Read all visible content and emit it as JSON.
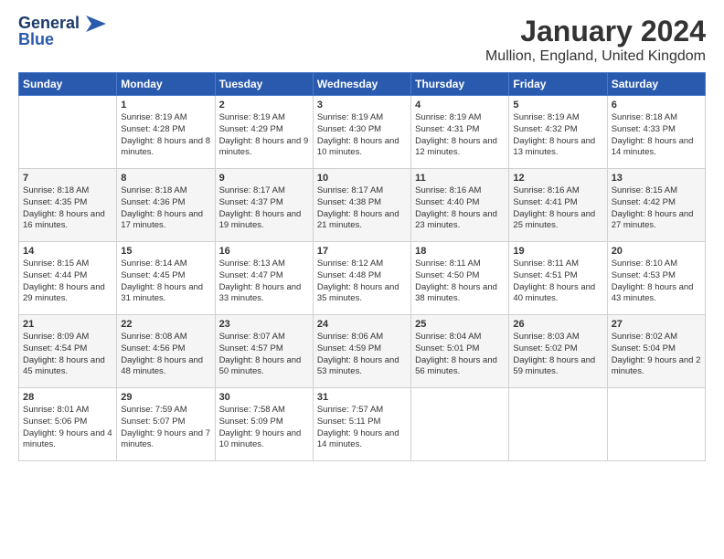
{
  "logo": {
    "line1": "General",
    "line2": "Blue"
  },
  "title": "January 2024",
  "subtitle": "Mullion, England, United Kingdom",
  "colors": {
    "header_bg": "#2a5aad",
    "accent": "#1a3a6b"
  },
  "days": [
    "Sunday",
    "Monday",
    "Tuesday",
    "Wednesday",
    "Thursday",
    "Friday",
    "Saturday"
  ],
  "weeks": [
    [
      {
        "day": "",
        "sunrise": "",
        "sunset": "",
        "daylight": ""
      },
      {
        "day": "1",
        "sunrise": "Sunrise: 8:19 AM",
        "sunset": "Sunset: 4:28 PM",
        "daylight": "Daylight: 8 hours and 8 minutes."
      },
      {
        "day": "2",
        "sunrise": "Sunrise: 8:19 AM",
        "sunset": "Sunset: 4:29 PM",
        "daylight": "Daylight: 8 hours and 9 minutes."
      },
      {
        "day": "3",
        "sunrise": "Sunrise: 8:19 AM",
        "sunset": "Sunset: 4:30 PM",
        "daylight": "Daylight: 8 hours and 10 minutes."
      },
      {
        "day": "4",
        "sunrise": "Sunrise: 8:19 AM",
        "sunset": "Sunset: 4:31 PM",
        "daylight": "Daylight: 8 hours and 12 minutes."
      },
      {
        "day": "5",
        "sunrise": "Sunrise: 8:19 AM",
        "sunset": "Sunset: 4:32 PM",
        "daylight": "Daylight: 8 hours and 13 minutes."
      },
      {
        "day": "6",
        "sunrise": "Sunrise: 8:18 AM",
        "sunset": "Sunset: 4:33 PM",
        "daylight": "Daylight: 8 hours and 14 minutes."
      }
    ],
    [
      {
        "day": "7",
        "sunrise": "Sunrise: 8:18 AM",
        "sunset": "Sunset: 4:35 PM",
        "daylight": "Daylight: 8 hours and 16 minutes."
      },
      {
        "day": "8",
        "sunrise": "Sunrise: 8:18 AM",
        "sunset": "Sunset: 4:36 PM",
        "daylight": "Daylight: 8 hours and 17 minutes."
      },
      {
        "day": "9",
        "sunrise": "Sunrise: 8:17 AM",
        "sunset": "Sunset: 4:37 PM",
        "daylight": "Daylight: 8 hours and 19 minutes."
      },
      {
        "day": "10",
        "sunrise": "Sunrise: 8:17 AM",
        "sunset": "Sunset: 4:38 PM",
        "daylight": "Daylight: 8 hours and 21 minutes."
      },
      {
        "day": "11",
        "sunrise": "Sunrise: 8:16 AM",
        "sunset": "Sunset: 4:40 PM",
        "daylight": "Daylight: 8 hours and 23 minutes."
      },
      {
        "day": "12",
        "sunrise": "Sunrise: 8:16 AM",
        "sunset": "Sunset: 4:41 PM",
        "daylight": "Daylight: 8 hours and 25 minutes."
      },
      {
        "day": "13",
        "sunrise": "Sunrise: 8:15 AM",
        "sunset": "Sunset: 4:42 PM",
        "daylight": "Daylight: 8 hours and 27 minutes."
      }
    ],
    [
      {
        "day": "14",
        "sunrise": "Sunrise: 8:15 AM",
        "sunset": "Sunset: 4:44 PM",
        "daylight": "Daylight: 8 hours and 29 minutes."
      },
      {
        "day": "15",
        "sunrise": "Sunrise: 8:14 AM",
        "sunset": "Sunset: 4:45 PM",
        "daylight": "Daylight: 8 hours and 31 minutes."
      },
      {
        "day": "16",
        "sunrise": "Sunrise: 8:13 AM",
        "sunset": "Sunset: 4:47 PM",
        "daylight": "Daylight: 8 hours and 33 minutes."
      },
      {
        "day": "17",
        "sunrise": "Sunrise: 8:12 AM",
        "sunset": "Sunset: 4:48 PM",
        "daylight": "Daylight: 8 hours and 35 minutes."
      },
      {
        "day": "18",
        "sunrise": "Sunrise: 8:11 AM",
        "sunset": "Sunset: 4:50 PM",
        "daylight": "Daylight: 8 hours and 38 minutes."
      },
      {
        "day": "19",
        "sunrise": "Sunrise: 8:11 AM",
        "sunset": "Sunset: 4:51 PM",
        "daylight": "Daylight: 8 hours and 40 minutes."
      },
      {
        "day": "20",
        "sunrise": "Sunrise: 8:10 AM",
        "sunset": "Sunset: 4:53 PM",
        "daylight": "Daylight: 8 hours and 43 minutes."
      }
    ],
    [
      {
        "day": "21",
        "sunrise": "Sunrise: 8:09 AM",
        "sunset": "Sunset: 4:54 PM",
        "daylight": "Daylight: 8 hours and 45 minutes."
      },
      {
        "day": "22",
        "sunrise": "Sunrise: 8:08 AM",
        "sunset": "Sunset: 4:56 PM",
        "daylight": "Daylight: 8 hours and 48 minutes."
      },
      {
        "day": "23",
        "sunrise": "Sunrise: 8:07 AM",
        "sunset": "Sunset: 4:57 PM",
        "daylight": "Daylight: 8 hours and 50 minutes."
      },
      {
        "day": "24",
        "sunrise": "Sunrise: 8:06 AM",
        "sunset": "Sunset: 4:59 PM",
        "daylight": "Daylight: 8 hours and 53 minutes."
      },
      {
        "day": "25",
        "sunrise": "Sunrise: 8:04 AM",
        "sunset": "Sunset: 5:01 PM",
        "daylight": "Daylight: 8 hours and 56 minutes."
      },
      {
        "day": "26",
        "sunrise": "Sunrise: 8:03 AM",
        "sunset": "Sunset: 5:02 PM",
        "daylight": "Daylight: 8 hours and 59 minutes."
      },
      {
        "day": "27",
        "sunrise": "Sunrise: 8:02 AM",
        "sunset": "Sunset: 5:04 PM",
        "daylight": "Daylight: 9 hours and 2 minutes."
      }
    ],
    [
      {
        "day": "28",
        "sunrise": "Sunrise: 8:01 AM",
        "sunset": "Sunset: 5:06 PM",
        "daylight": "Daylight: 9 hours and 4 minutes."
      },
      {
        "day": "29",
        "sunrise": "Sunrise: 7:59 AM",
        "sunset": "Sunset: 5:07 PM",
        "daylight": "Daylight: 9 hours and 7 minutes."
      },
      {
        "day": "30",
        "sunrise": "Sunrise: 7:58 AM",
        "sunset": "Sunset: 5:09 PM",
        "daylight": "Daylight: 9 hours and 10 minutes."
      },
      {
        "day": "31",
        "sunrise": "Sunrise: 7:57 AM",
        "sunset": "Sunset: 5:11 PM",
        "daylight": "Daylight: 9 hours and 14 minutes."
      },
      {
        "day": "",
        "sunrise": "",
        "sunset": "",
        "daylight": ""
      },
      {
        "day": "",
        "sunrise": "",
        "sunset": "",
        "daylight": ""
      },
      {
        "day": "",
        "sunrise": "",
        "sunset": "",
        "daylight": ""
      }
    ]
  ]
}
